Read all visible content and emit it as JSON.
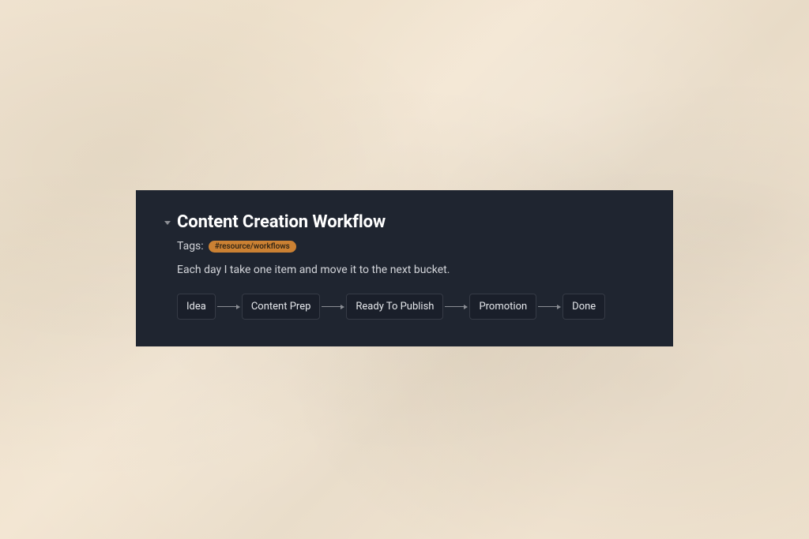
{
  "header": {
    "title": "Content Creation Workflow"
  },
  "tags": {
    "label": "Tags:",
    "items": [
      {
        "text": "#resource/workflows"
      }
    ]
  },
  "description": "Each day I take one item and move it to the next bucket.",
  "workflow": {
    "stages": [
      {
        "label": "Idea"
      },
      {
        "label": "Content Prep"
      },
      {
        "label": "Ready To Publish"
      },
      {
        "label": "Promotion"
      },
      {
        "label": "Done"
      }
    ]
  }
}
